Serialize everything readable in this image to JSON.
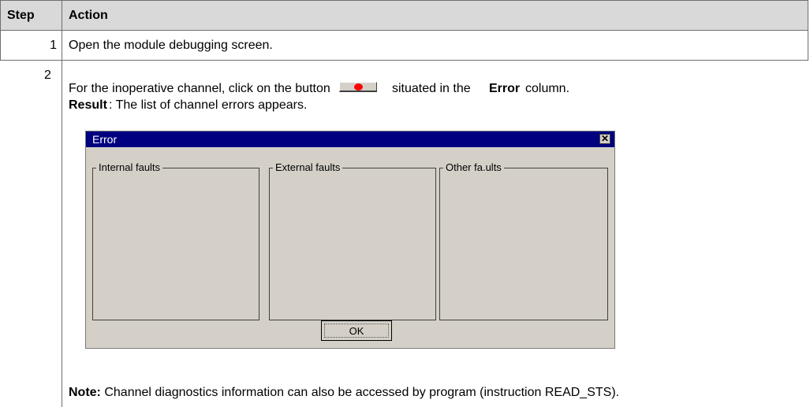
{
  "table": {
    "headers": {
      "step": "Step",
      "action": "Action"
    },
    "rows": [
      {
        "step": "1",
        "text": "Open the module debugging screen."
      },
      {
        "step": "2",
        "line1_before": "For the inoperative channel, click on the button",
        "line1_after": "situated in the",
        "line1_bold": "Error",
        "line1_end": "column.",
        "result_label": "Result",
        "result_text": ": The list of channel errors appears.",
        "note_label": "Note:",
        "note_text": " Channel diagnostics information can also be accessed by program (instruction READ_STS)."
      }
    ]
  },
  "dialog": {
    "title": "Error",
    "close_glyph": "✕",
    "groups": [
      "Internal faults",
      "External faults",
      "Other fa.ults"
    ],
    "ok_label": "OK"
  },
  "colors": {
    "header_bg": "#d9d9d9",
    "dialog_title_bg": "#000080",
    "dialog_bg": "#d4d0c8",
    "error_dot": "#ff0000"
  }
}
